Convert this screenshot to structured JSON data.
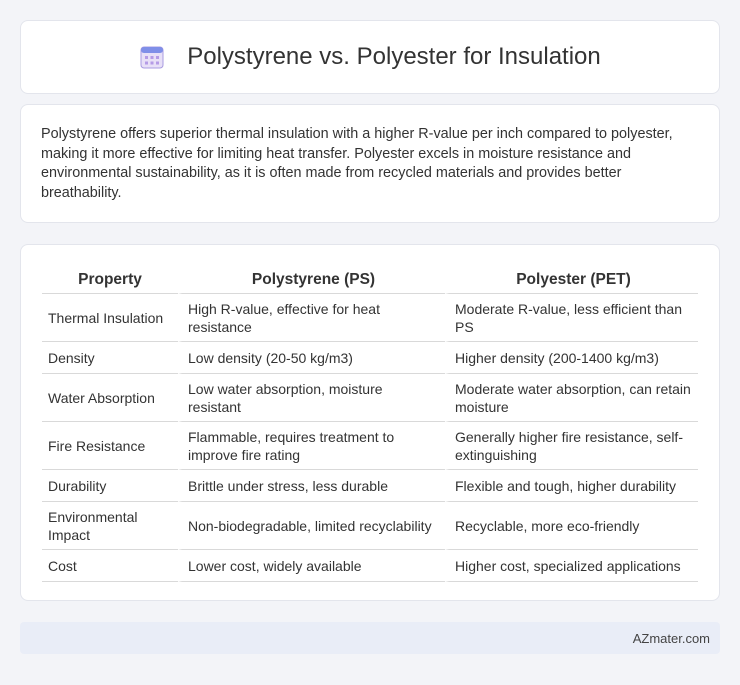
{
  "header": {
    "title": "Polystyrene vs. Polyester for Insulation",
    "icon": "calendar-icon"
  },
  "intro": "Polystyrene offers superior thermal insulation with a higher R-value per inch compared to polyester, making it more effective for limiting heat transfer. Polyester excels in moisture resistance and environmental sustainability, as it is often made from recycled materials and provides better breathability.",
  "table": {
    "headers": [
      "Property",
      "Polystyrene (PS)",
      "Polyester (PET)"
    ],
    "rows": [
      [
        "Thermal Insulation",
        "High R-value, effective for heat resistance",
        "Moderate R-value, less efficient than PS"
      ],
      [
        "Density",
        "Low density (20-50 kg/m3)",
        "Higher density (200-1400 kg/m3)"
      ],
      [
        "Water Absorption",
        "Low water absorption, moisture resistant",
        "Moderate water absorption, can retain moisture"
      ],
      [
        "Fire Resistance",
        "Flammable, requires treatment to improve fire rating",
        "Generally higher fire resistance, self-extinguishing"
      ],
      [
        "Durability",
        "Brittle under stress, less durable",
        "Flexible and tough, higher durability"
      ],
      [
        "Environmental Impact",
        "Non-biodegradable, limited recyclability",
        "Recyclable, more eco-friendly"
      ],
      [
        "Cost",
        "Lower cost, widely available",
        "Higher cost, specialized applications"
      ]
    ]
  },
  "footer": {
    "brand": "AZmater.com"
  }
}
